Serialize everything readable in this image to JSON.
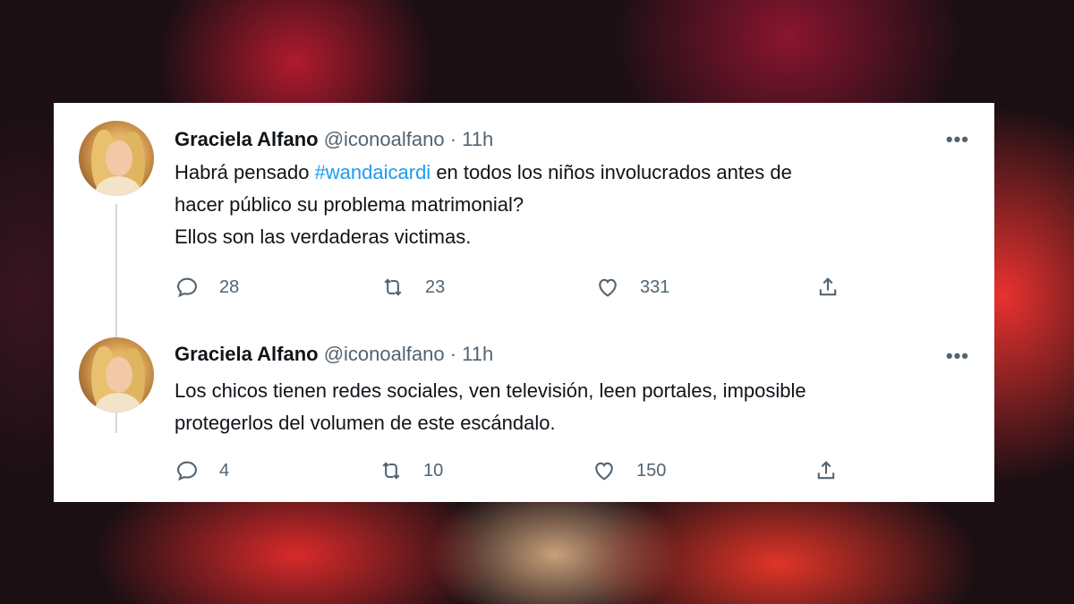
{
  "tweets": [
    {
      "name": "Graciela Alfano",
      "handle": "@iconoalfano",
      "separator": "·",
      "time": "11h",
      "text_before": "Habrá pensado ",
      "hashtag": "#wandaicardi",
      "text_after": " en todos los niños involucrados antes de\nhacer público su problema matrimonial?\nEllos son las verdaderas victimas.",
      "more": "•••",
      "replies": "28",
      "retweets": "23",
      "likes": "331"
    },
    {
      "name": "Graciela Alfano",
      "handle": "@iconoalfano",
      "separator": "·",
      "time": "11h",
      "text": "Los chicos tienen redes sociales, ven televisión, leen portales, imposible\nprotegerlos del volumen de este escándalo.",
      "more": "•••",
      "replies": "4",
      "retweets": "10",
      "likes": "150"
    }
  ],
  "icons": {
    "reply": "reply-icon",
    "retweet": "retweet-icon",
    "like": "heart-icon",
    "share": "share-icon",
    "more": "more-options-icon"
  },
  "colors": {
    "hashtag": "#1d9bf0",
    "secondary_text": "#536471",
    "primary_text": "#0f1419"
  }
}
